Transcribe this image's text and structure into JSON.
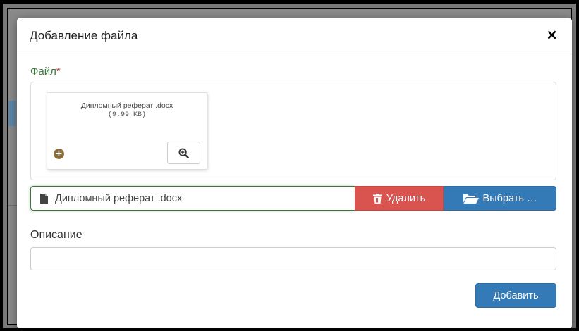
{
  "modal": {
    "title": "Добавление файла",
    "close_glyph": "×",
    "file_label": "Файл",
    "required_mark": "*",
    "preview": {
      "file_name": "Дипломный реферат .docx",
      "file_size": "(9.99 KB)"
    },
    "caption_value": "Дипломный реферат .docx",
    "remove_label": "Удалить",
    "browse_label": "Выбрать …",
    "description_label": "Описание",
    "description_value": "",
    "add_label": "Добавить"
  },
  "colors": {
    "label_success": "#3c763d",
    "danger": "#d9534f",
    "primary": "#337ab7"
  },
  "icons": {
    "close": "close-icon",
    "drag": "plus-circle-icon",
    "zoom": "zoom-in-icon",
    "document": "file-icon",
    "remove": "trash-icon",
    "browse": "folder-open-icon"
  }
}
